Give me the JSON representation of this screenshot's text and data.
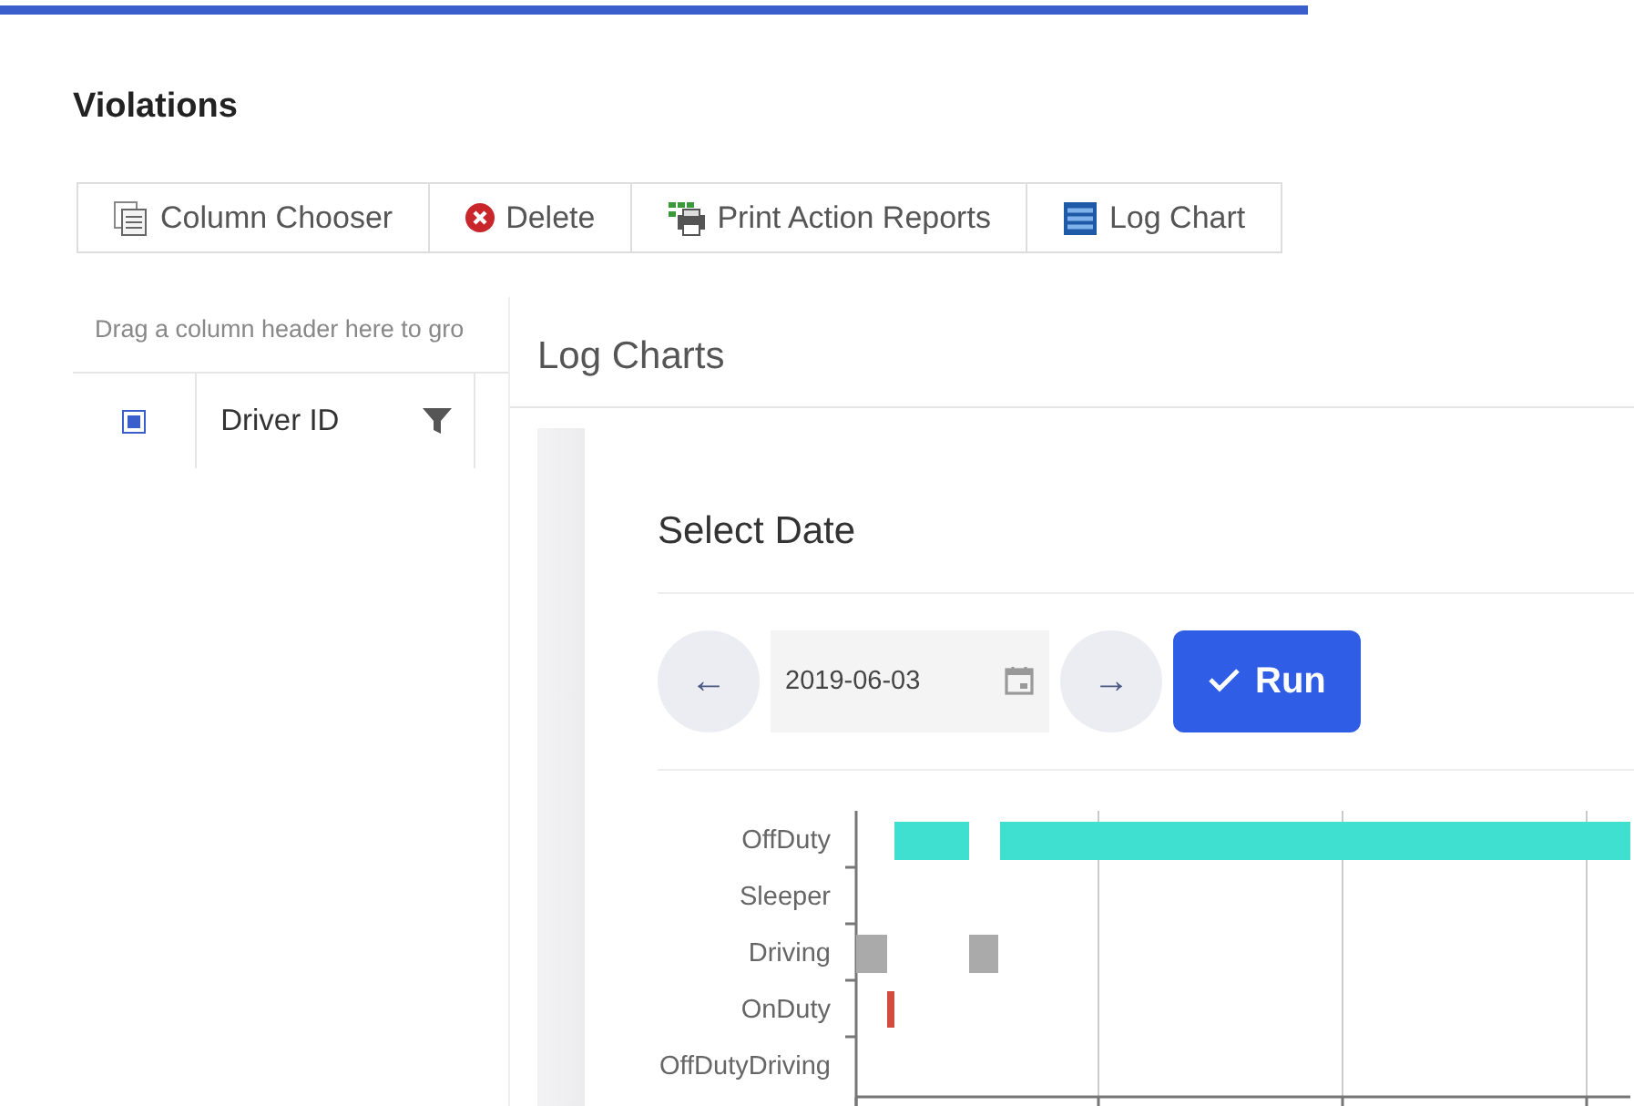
{
  "progress": {
    "level": 0.8
  },
  "page": {
    "title": "Violations"
  },
  "toolbar": [
    {
      "kind": "columns",
      "label": "Column Chooser"
    },
    {
      "kind": "delete",
      "label": "Delete"
    },
    {
      "kind": "print",
      "label": "Print Action Reports"
    },
    {
      "kind": "logchart",
      "label": "Log Chart"
    }
  ],
  "grid": {
    "group_hint": "Drag a column header here to gro",
    "select_all": {
      "checked": true
    },
    "columns": [
      {
        "label": "Driver ID"
      }
    ]
  },
  "log_charts": {
    "title": "Log Charts",
    "section_title": "Select Date",
    "prev_button": "←",
    "date": {
      "value": "2019-06-03"
    },
    "next_button": "→",
    "run_button": "Run",
    "chart": {
      "row_labels": [
        "OffDuty",
        "Sleeper",
        "Driving",
        "OnDuty",
        "OffDutyDriving"
      ]
    }
  }
}
